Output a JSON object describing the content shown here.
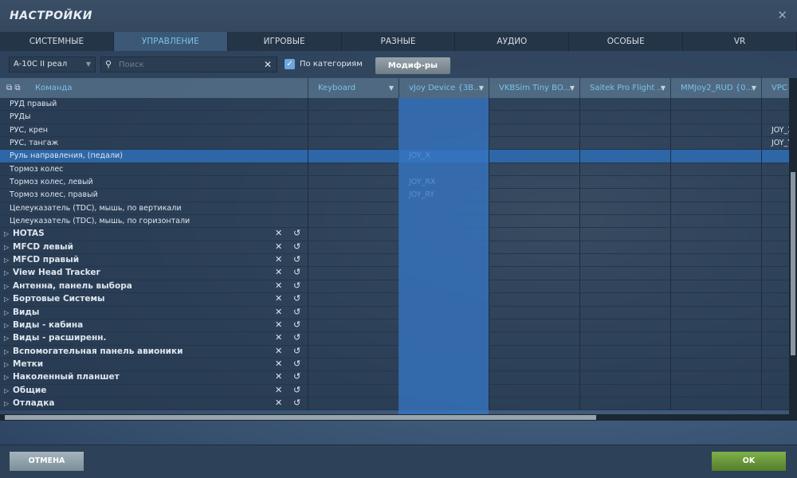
{
  "window": {
    "title": "НАСТРОЙКИ",
    "close_icon": "close-icon"
  },
  "tabs": [
    {
      "label": "СИСТЕМНЫЕ"
    },
    {
      "label": "УПРАВЛЕНИЕ",
      "active": true
    },
    {
      "label": "ИГРОВЫЕ"
    },
    {
      "label": "РАЗНЫЕ"
    },
    {
      "label": "АУДИО"
    },
    {
      "label": "ОСОБЫЕ"
    },
    {
      "label": "VR"
    }
  ],
  "toolbar": {
    "aircraft": "A-10C II реал",
    "search_placeholder": "Поиск",
    "search_value": "",
    "by_categories_label": "По категориям",
    "by_categories_checked": true,
    "modifiers_label": "Модиф-ры"
  },
  "columns": [
    "Команда",
    "Keyboard",
    "vJoy Device {3B...",
    "VKBSim Tiny BO...",
    "Saitek Pro Flight ...",
    "MMJoy2_RUD {0...",
    "VPC S"
  ],
  "rows": [
    {
      "cmd": "РУД правый",
      "b": [
        "",
        "",
        "",
        "",
        "",
        ""
      ]
    },
    {
      "cmd": "РУДы",
      "b": [
        "",
        "",
        "",
        "",
        "",
        ""
      ]
    },
    {
      "cmd": "РУС, крен",
      "b": [
        "",
        "",
        "",
        "",
        "",
        "JOY_X"
      ]
    },
    {
      "cmd": "РУС, тангаж",
      "b": [
        "",
        "",
        "",
        "",
        "",
        "JOY_Y"
      ]
    },
    {
      "cmd": "Руль направления, (педали)",
      "b": [
        "",
        "JOY_X",
        "",
        "",
        "",
        ""
      ],
      "selected": true
    },
    {
      "cmd": "Тормоз колес",
      "b": [
        "",
        "",
        "",
        "",
        "",
        ""
      ]
    },
    {
      "cmd": "Тормоз колес, левый",
      "b": [
        "",
        "JOY_RX",
        "",
        "",
        "",
        ""
      ]
    },
    {
      "cmd": "Тормоз колес, правый",
      "b": [
        "",
        "JOY_RY",
        "",
        "",
        "",
        ""
      ]
    },
    {
      "cmd": "Целеуказатель (TDC), мышь, по вертикали",
      "b": [
        "",
        "",
        "",
        "",
        "",
        ""
      ]
    },
    {
      "cmd": "Целеуказатель (TDC), мышь, по горизонтали",
      "b": [
        "",
        "",
        "",
        "",
        "",
        ""
      ]
    }
  ],
  "categories": [
    "HOTAS",
    "MFCD левый",
    "MFCD правый",
    "View Head Tracker",
    "Антенна, панель выбора",
    "Бортовые Системы",
    "Виды",
    "Виды - кабина",
    "Виды - расширенн.",
    "Вспомогательная панель авионики",
    "Метки",
    "Наколенный планшет",
    "Общие",
    "Отладка"
  ],
  "accent": {
    "selected_row": "#2e67a8",
    "highlight_column": "#3676c3",
    "header_text": "#79c2ea",
    "ok": "#6a9a3a"
  },
  "footer": {
    "cancel_label": "ОТМЕНА",
    "ok_label": "OK"
  }
}
